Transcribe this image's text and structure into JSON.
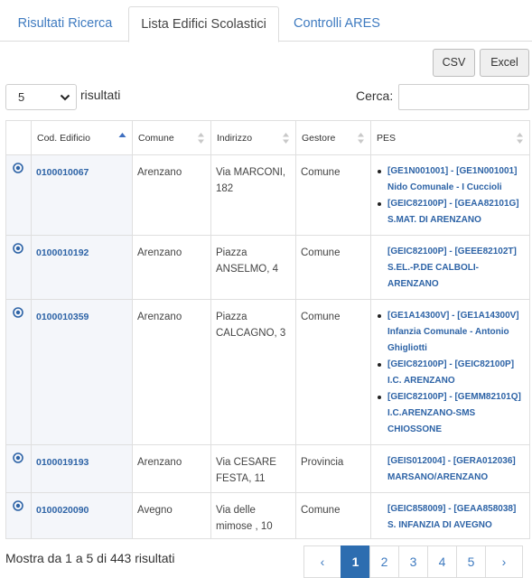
{
  "tabs": [
    {
      "label": "Risultati Ricerca",
      "active": false
    },
    {
      "label": "Lista Edifici Scolastici",
      "active": true
    },
    {
      "label": "Controlli ARES",
      "active": false
    }
  ],
  "toolbar": {
    "csv_label": "CSV",
    "excel_label": "Excel",
    "page_length": "5",
    "page_length_suffix": "risultati",
    "search_label": "Cerca:",
    "search_value": ""
  },
  "table": {
    "columns": [
      "Cod. Edificio",
      "Comune",
      "Indirizzo",
      "Gestore",
      "PES"
    ],
    "sorted_column": "Cod. Edificio",
    "sort_direction": "asc",
    "rows": [
      {
        "code": "0100010067",
        "comune": "Arenzano",
        "indirizzo": "Via MARCONI, 182",
        "gestore": "Comune",
        "pes": [
          "[GE1N001001] - [GE1N001001] Nido Comunale - I Cuccioli",
          "[GEIC82100P] - [GEAA82101G] S.MAT. DI ARENZANO"
        ]
      },
      {
        "code": "0100010192",
        "comune": "Arenzano",
        "indirizzo": "Piazza ANSELMO, 4",
        "gestore": "Comune",
        "pes": [
          "[GEIC82100P] - [GEEE82102T] S.EL.-P.DE CALBOLI-ARENZANO"
        ]
      },
      {
        "code": "0100010359",
        "comune": "Arenzano",
        "indirizzo": "Piazza CALCAGNO, 3",
        "gestore": "Comune",
        "pes": [
          "[GE1A14300V] - [GE1A14300V] Infanzia Comunale - Antonio Ghigliotti",
          "[GEIC82100P] - [GEIC82100P] I.C. ARENZANO",
          "[GEIC82100P] - [GEMM82101Q] I.C.ARENZANO-SMS CHIOSSONE"
        ]
      },
      {
        "code": "0100019193",
        "comune": "Arenzano",
        "indirizzo": "Via CESARE FESTA, 11",
        "gestore": "Provincia",
        "pes": [
          "[GEIS012004] - [GERA012036] MARSANO/ARENZANO"
        ]
      },
      {
        "code": "0100020090",
        "comune": "Avegno",
        "indirizzo": "Via delle mimose , 10",
        "gestore": "Comune",
        "pes": [
          "[GEIC858009] - [GEAA858038] S. INFANZIA DI AVEGNO"
        ]
      }
    ],
    "row_icon": "eye-icon"
  },
  "footer": {
    "info": "Mostra da 1 a 5 di 443 risultati",
    "pages": [
      "1",
      "2",
      "3",
      "4",
      "5"
    ],
    "current_page": "1",
    "prev_label": "‹",
    "next_label": "›"
  },
  "colors": {
    "link": "#2d63a6",
    "tab_link": "#3f7bc0",
    "active_page": "#2d6db0"
  }
}
